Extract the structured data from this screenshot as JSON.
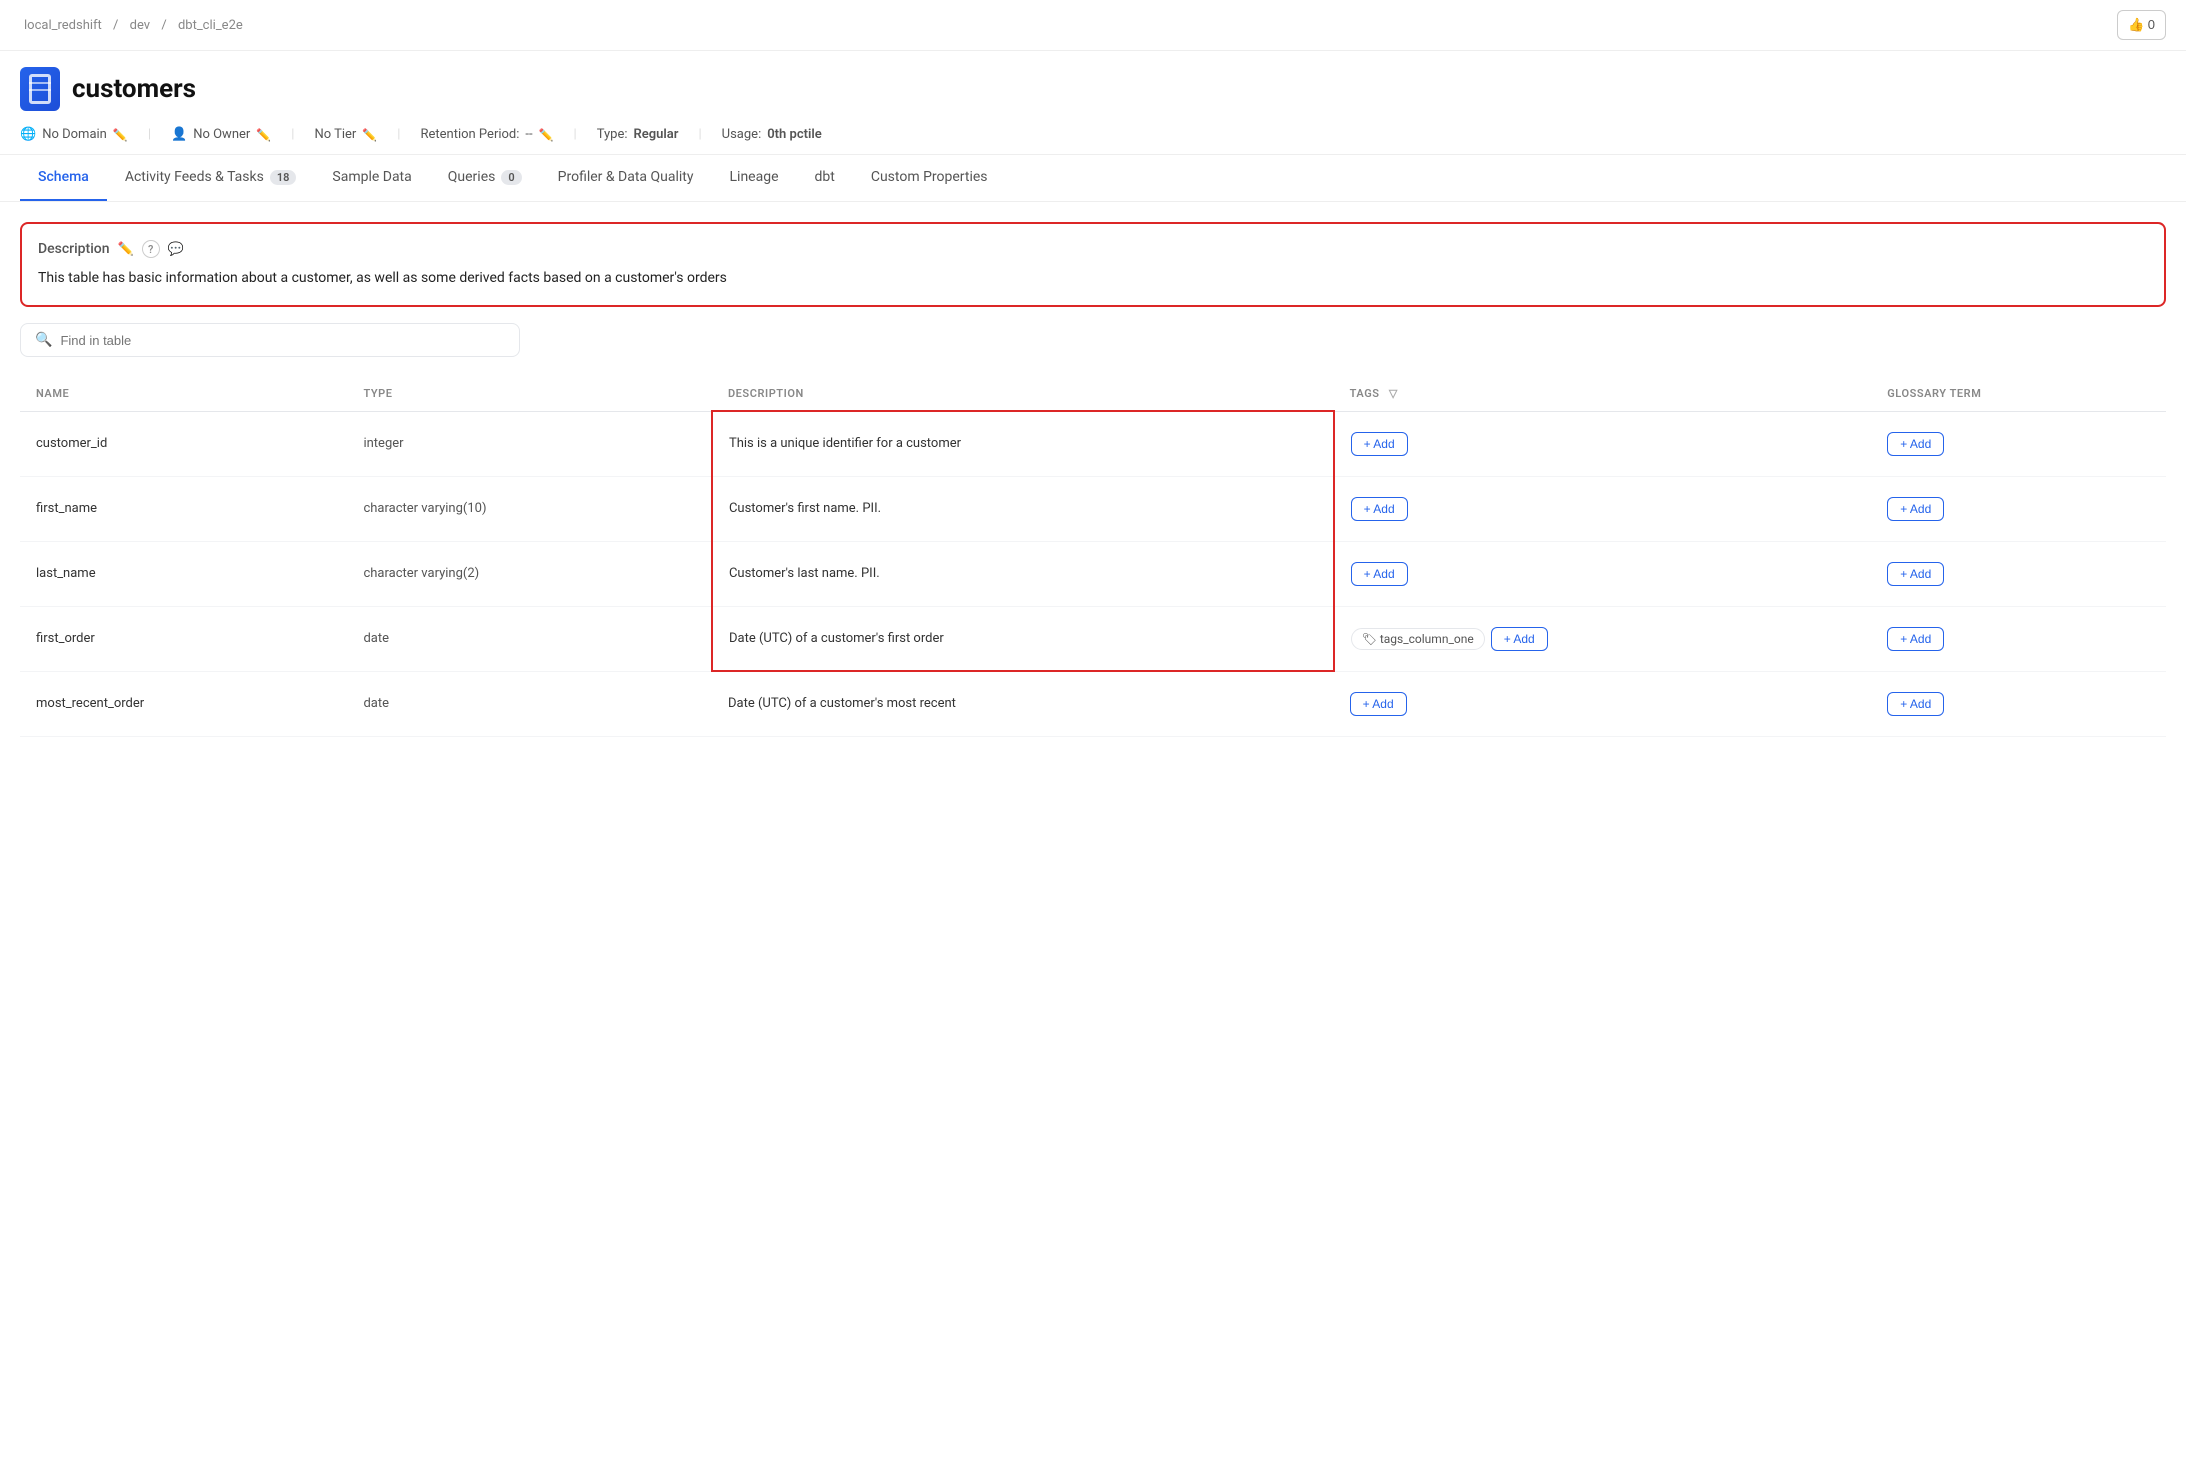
{
  "breadcrumb": {
    "parts": [
      "local_redshift",
      "dev",
      "dbt_cli_e2e"
    ]
  },
  "header": {
    "title": "customers"
  },
  "meta": {
    "domain": "No Domain",
    "owner": "No Owner",
    "tier": "No Tier",
    "retention": "--",
    "type": "Regular",
    "usage": "0th pctile"
  },
  "tabs": [
    {
      "label": "Schema",
      "active": true,
      "badge": null
    },
    {
      "label": "Activity Feeds & Tasks",
      "active": false,
      "badge": "18"
    },
    {
      "label": "Sample Data",
      "active": false,
      "badge": null
    },
    {
      "label": "Queries",
      "active": false,
      "badge": "0"
    },
    {
      "label": "Profiler & Data Quality",
      "active": false,
      "badge": null
    },
    {
      "label": "Lineage",
      "active": false,
      "badge": null
    },
    {
      "label": "dbt",
      "active": false,
      "badge": null
    },
    {
      "label": "Custom Properties",
      "active": false,
      "badge": null
    }
  ],
  "description": {
    "label": "Description",
    "text": "This table has basic information about a customer, as well as some derived facts based on a customer's orders"
  },
  "search": {
    "placeholder": "Find in table"
  },
  "table": {
    "columns": [
      "NAME",
      "TYPE",
      "DESCRIPTION",
      "TAGS",
      "GLOSSARY TERM"
    ],
    "rows": [
      {
        "name": "customer_id",
        "type": "integer",
        "description": "This is a unique identifier for a customer",
        "tags": [],
        "glossary": []
      },
      {
        "name": "first_name",
        "type": "character varying(10)",
        "description": "Customer's first name. PII.",
        "tags": [],
        "glossary": []
      },
      {
        "name": "last_name",
        "type": "character varying(2)",
        "description": "Customer's last name. PII.",
        "tags": [],
        "glossary": []
      },
      {
        "name": "first_order",
        "type": "date",
        "description": "Date (UTC) of a customer's first order",
        "tags": [
          "tags_column_one"
        ],
        "glossary": []
      },
      {
        "name": "most_recent_order",
        "type": "date",
        "description": "Date (UTC) of a customer's most recent",
        "tags": [],
        "glossary": []
      }
    ]
  },
  "icons": {
    "thumbsup": "👍",
    "globe": "🌐",
    "user": "👤",
    "edit": "✏️",
    "search": "🔍",
    "filter": "▽",
    "tag": "🏷",
    "question": "?",
    "chat": "💬"
  }
}
